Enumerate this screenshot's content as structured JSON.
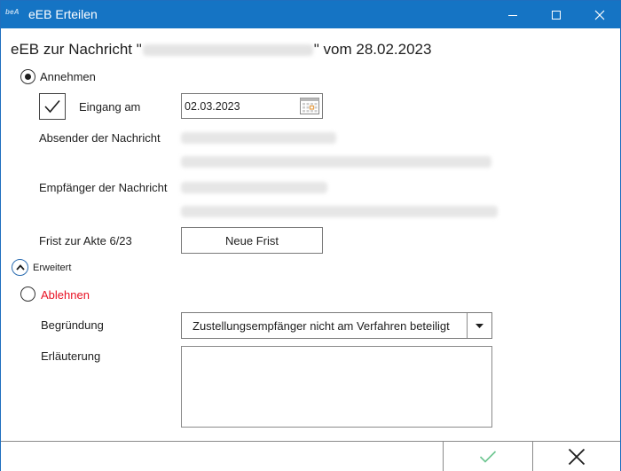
{
  "window": {
    "app_logo": "beA",
    "title": "eEB Erteilen"
  },
  "heading": {
    "prefix": "eEB zur Nachricht \"",
    "subject": "Nachricht für Hauptpostfach",
    "suffix": "\" vom 28.02.2023"
  },
  "accept": {
    "label": "Annehmen",
    "selected": true,
    "received_label": "Eingang am",
    "received_checked": true,
    "received_date": "02.03.2023",
    "sender_label": "Absender der Nachricht",
    "recipient_label": "Empfänger der Nachricht",
    "deadline_label": "Frist zur Akte 6/23",
    "deadline_button": "Neue Frist"
  },
  "expander": {
    "label": "Erweitert",
    "expanded": true
  },
  "reject": {
    "label": "Ablehnen",
    "selected": false,
    "color": "#e81123",
    "reason_label": "Begründung",
    "reason_value": "Zustellungsempfänger nicht am Verfahren beteiligt",
    "explanation_label": "Erläuterung",
    "explanation_value": ""
  },
  "colors": {
    "titlebar": "#1574c4",
    "ok_check": "#6cc58f",
    "calendar_accent": "#e8a04a"
  },
  "icons": {
    "minimize": "minimize-icon",
    "maximize": "maximize-icon",
    "close": "close-icon",
    "calendar": "calendar-icon",
    "expander": "chevron-up-icon",
    "dropdown": "caret-down-icon",
    "ok": "check-icon",
    "cancel": "x-icon"
  }
}
